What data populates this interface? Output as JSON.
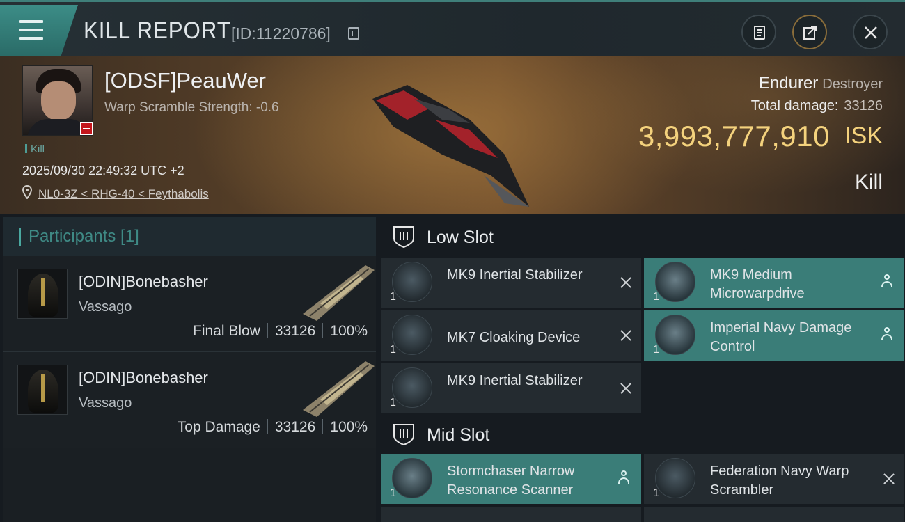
{
  "header": {
    "title": "KILL REPORT",
    "report_id": "[ID:11220786]",
    "icons": [
      "menu-icon",
      "copy-icon",
      "clipboard-icon",
      "share-icon",
      "close-icon"
    ]
  },
  "victim": {
    "name": "[ODSF]PeauWer",
    "warp_scramble": "Warp Scramble Strength: -0.6",
    "tag": "Kill",
    "datetime": "2025/09/30 22:49:32 UTC +2",
    "location": "NL0-3Z < RHG-40 < Feythabolis",
    "ship_name": "Endurer",
    "ship_class": "Destroyer",
    "total_damage_label": "Total damage:",
    "total_damage_value": "33126",
    "isk_value": "3,993,777,910",
    "isk_unit": "ISK",
    "result": "Kill"
  },
  "participants": {
    "header": "Participants [1]",
    "rows": [
      {
        "name": "[ODIN]Bonebasher",
        "ship": "Vassago",
        "role": "Final Blow",
        "damage": "33126",
        "percent": "100%"
      },
      {
        "name": "[ODIN]Bonebasher",
        "ship": "Vassago",
        "role": "Top Damage",
        "damage": "33126",
        "percent": "100%"
      }
    ]
  },
  "fitting": {
    "low_slot_label": "Low Slot",
    "mid_slot_label": "Mid Slot",
    "low_slot": [
      {
        "name": "MK9 Inertial Stabilizer",
        "qty": "1",
        "status": "destroyed",
        "icon": "inertial-stabilizer-icon"
      },
      {
        "name": "MK9 Medium Microwarpdrive",
        "qty": "1",
        "status": "dropped",
        "icon": "microwarpdrive-icon"
      },
      {
        "name": "MK7 Cloaking Device",
        "qty": "1",
        "status": "destroyed",
        "icon": "cloaking-device-icon"
      },
      {
        "name": "Imperial Navy Damage Control",
        "qty": "1",
        "status": "dropped",
        "icon": "damage-control-icon"
      },
      {
        "name": "MK9 Inertial Stabilizer",
        "qty": "1",
        "status": "destroyed",
        "icon": "inertial-stabilizer-icon"
      }
    ],
    "mid_slot": [
      {
        "name": "Stormchaser Narrow Resonance Scanner",
        "qty": "1",
        "status": "dropped",
        "icon": "scanner-icon"
      },
      {
        "name": "Federation Navy Warp Scrambler",
        "qty": "1",
        "status": "destroyed",
        "icon": "warp-scrambler-icon"
      }
    ]
  },
  "colors": {
    "accent_teal": "#3a7d78",
    "isk_gold": "#f4d27d",
    "destroyed_badge": "#c4161c"
  }
}
